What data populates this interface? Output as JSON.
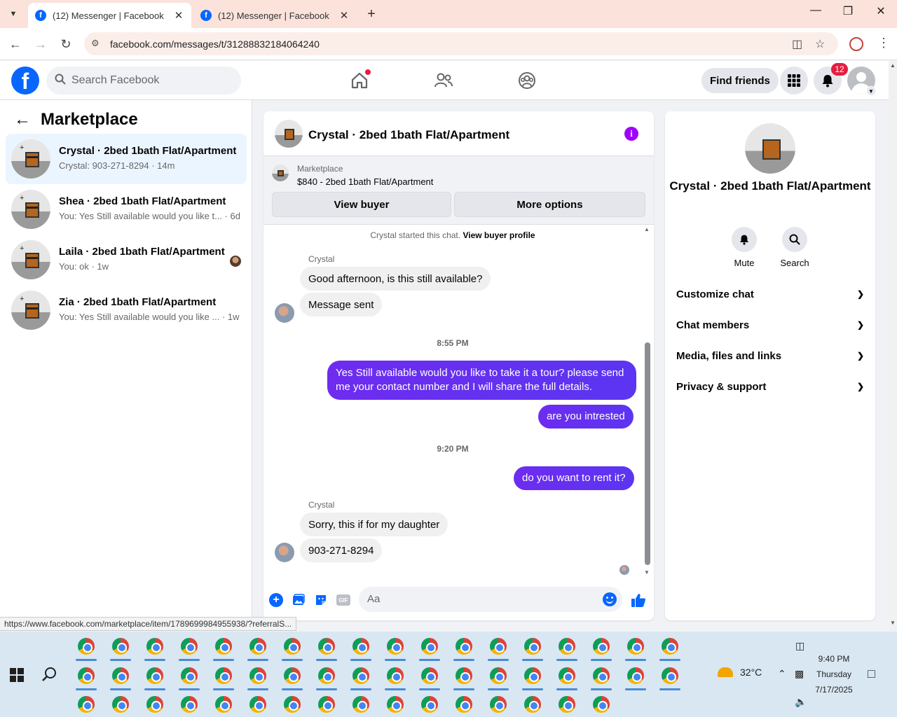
{
  "browser": {
    "tabs": [
      {
        "title": "(12) Messenger | Facebook",
        "active": true
      },
      {
        "title": "(12) Messenger | Facebook",
        "active": false
      }
    ],
    "url": "facebook.com/messages/t/31288832184064240",
    "status_url": "https://www.facebook.com/marketplace/item/1789699984955938/?referralS..."
  },
  "fb_header": {
    "search_placeholder": "Search Facebook",
    "find_friends_label": "Find friends",
    "notification_count": "12"
  },
  "sidebar": {
    "title": "Marketplace",
    "conversations": [
      {
        "name": "Crystal · 2bed 1bath Flat/Apartment",
        "preview": "Crystal: 903-271-8294 · 14m",
        "active": true
      },
      {
        "name": "Shea · 2bed 1bath Flat/Apartment",
        "preview": "You: Yes Still available would you like t... · 6d",
        "active": false
      },
      {
        "name": "Laila · 2bed 1bath Flat/Apartment",
        "preview": "You: ok · 1w",
        "active": false
      },
      {
        "name": "Zia · 2bed 1bath Flat/Apartment",
        "preview": "You: Yes Still available would you like ... · 1w",
        "active": false
      }
    ]
  },
  "chat": {
    "title": "Crystal · 2bed 1bath Flat/Apartment",
    "marketplace_label": "Marketplace",
    "listing": "$840 - 2bed 1bath Flat/Apartment",
    "view_buyer": "View buyer",
    "more_options": "More options",
    "started_text": "Crystal started this chat.",
    "view_buyer_profile": "View buyer profile",
    "sender_name": "Crystal",
    "messages": {
      "m1": "Good afternoon, is this still available?",
      "m2": "Message sent",
      "t1": "8:55 PM",
      "m3": "Yes Still available would you like to take it a tour? please send me your contact number and I will share the full details.",
      "m4": "are you  intrested",
      "t2": "9:20 PM",
      "m5": "do you want to rent it?",
      "m6": "Sorry, this if for my daughter",
      "m7": "903-271-8294"
    },
    "composer_placeholder": "Aa",
    "gif_label": "GIF"
  },
  "info_panel": {
    "name": "Crystal · 2bed 1bath Flat/Apartment",
    "actions": {
      "mute": "Mute",
      "search": "Search"
    },
    "sections": [
      "Customize chat",
      "Chat members",
      "Media, files and links",
      "Privacy & support"
    ]
  },
  "taskbar": {
    "temperature": "32°C",
    "weather_badge": "1",
    "time": "9:40 PM",
    "day": "Thursday",
    "date": "7/17/2025"
  },
  "colors": {
    "brand": "#0866ff",
    "outgoing_bubble": "#5b35f1",
    "active_conversation": "#ebf5ff",
    "notification_red": "#e41e3f"
  }
}
